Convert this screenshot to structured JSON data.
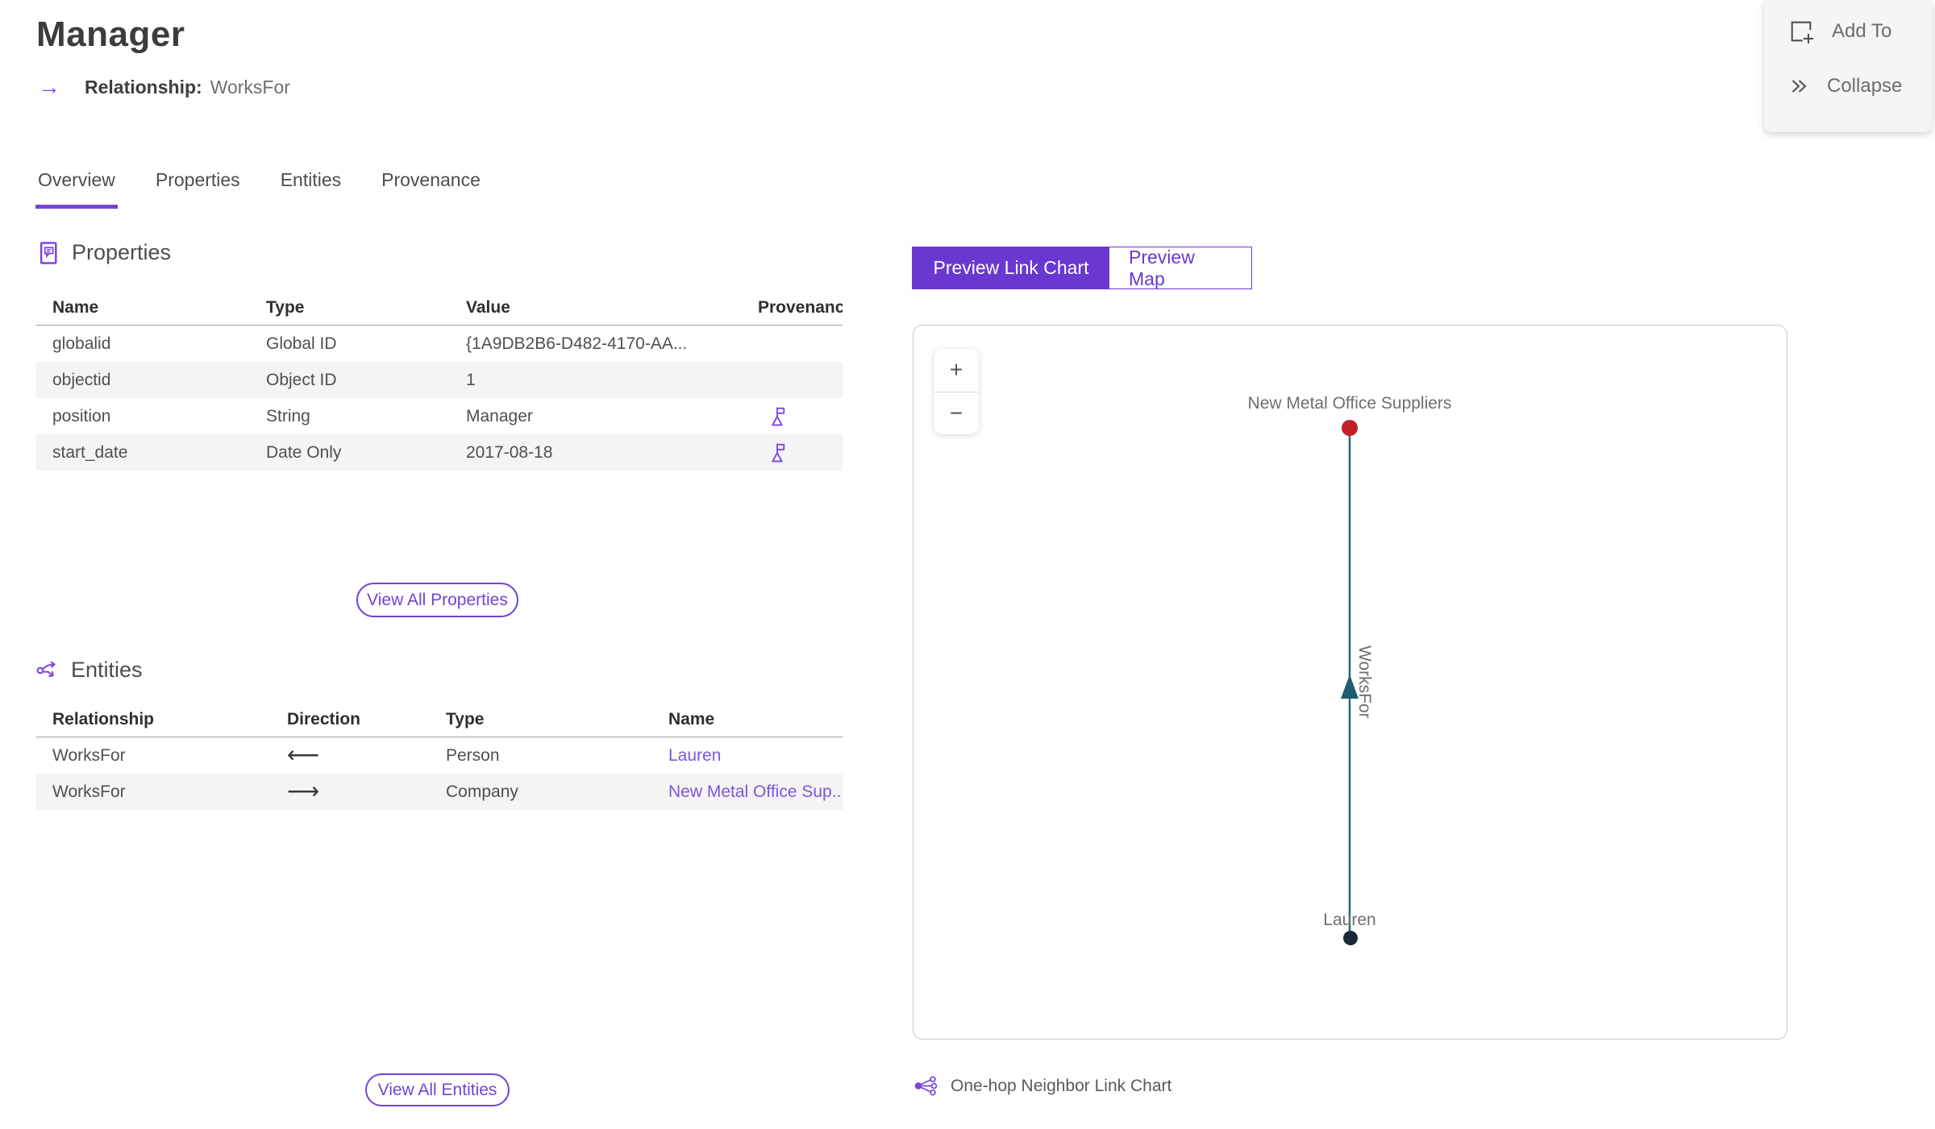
{
  "header": {
    "title": "Manager",
    "arrow_glyph": "→",
    "subtitle_label": "Relationship:",
    "subtitle_value": "WorksFor"
  },
  "actions": {
    "add_to": "Add To",
    "collapse": "Collapse"
  },
  "tabs": [
    {
      "label": "Overview",
      "active": true
    },
    {
      "label": "Properties",
      "active": false
    },
    {
      "label": "Entities",
      "active": false
    },
    {
      "label": "Provenance",
      "active": false
    }
  ],
  "properties_section": {
    "title": "Properties",
    "columns": {
      "name": "Name",
      "type": "Type",
      "value": "Value",
      "provenance": "Provenance"
    },
    "rows": [
      {
        "name": "globalid",
        "type": "Global ID",
        "value": "{1A9DB2B6-D482-4170-AA...",
        "has_provenance": false
      },
      {
        "name": "objectid",
        "type": "Object ID",
        "value": "1",
        "has_provenance": false
      },
      {
        "name": "position",
        "type": "String",
        "value": "Manager",
        "has_provenance": true
      },
      {
        "name": "start_date",
        "type": "Date Only",
        "value": "2017-08-18",
        "has_provenance": true
      }
    ],
    "view_all_label": "View All Properties"
  },
  "entities_section": {
    "title": "Entities",
    "columns": {
      "relationship": "Relationship",
      "direction": "Direction",
      "type": "Type",
      "name": "Name"
    },
    "rows": [
      {
        "relationship": "WorksFor",
        "direction_glyph": "⟵",
        "direction": "incoming",
        "type": "Person",
        "name": "Lauren"
      },
      {
        "relationship": "WorksFor",
        "direction_glyph": "⟶",
        "direction": "outgoing",
        "type": "Company",
        "name": "New Metal Office Sup..."
      }
    ],
    "view_all_label": "View All Entities"
  },
  "preview": {
    "link_chart_label": "Preview Link Chart",
    "map_label": "Preview Map",
    "active": "Preview Link Chart",
    "zoom_in": "+",
    "zoom_out": "−",
    "caption": "One-hop Neighbor Link Chart",
    "graph": {
      "nodes": [
        {
          "label": "New Metal Office Suppliers",
          "type": "Company",
          "color": "#c02125"
        },
        {
          "label": "Lauren",
          "type": "Person",
          "color": "#1c2a38"
        }
      ],
      "edge": {
        "label": "WorksFor",
        "from": "Lauren",
        "to": "New Metal Office Suppliers",
        "color": "#266878"
      }
    }
  },
  "colors": {
    "accent_purple": "#6938d0",
    "icon_purple": "#7a45e0",
    "link_purple": "#7d55e2",
    "edge_teal": "#266878",
    "node_red": "#c02125",
    "node_navy": "#1c2a38",
    "row_stripe": "#f4f4f4"
  }
}
